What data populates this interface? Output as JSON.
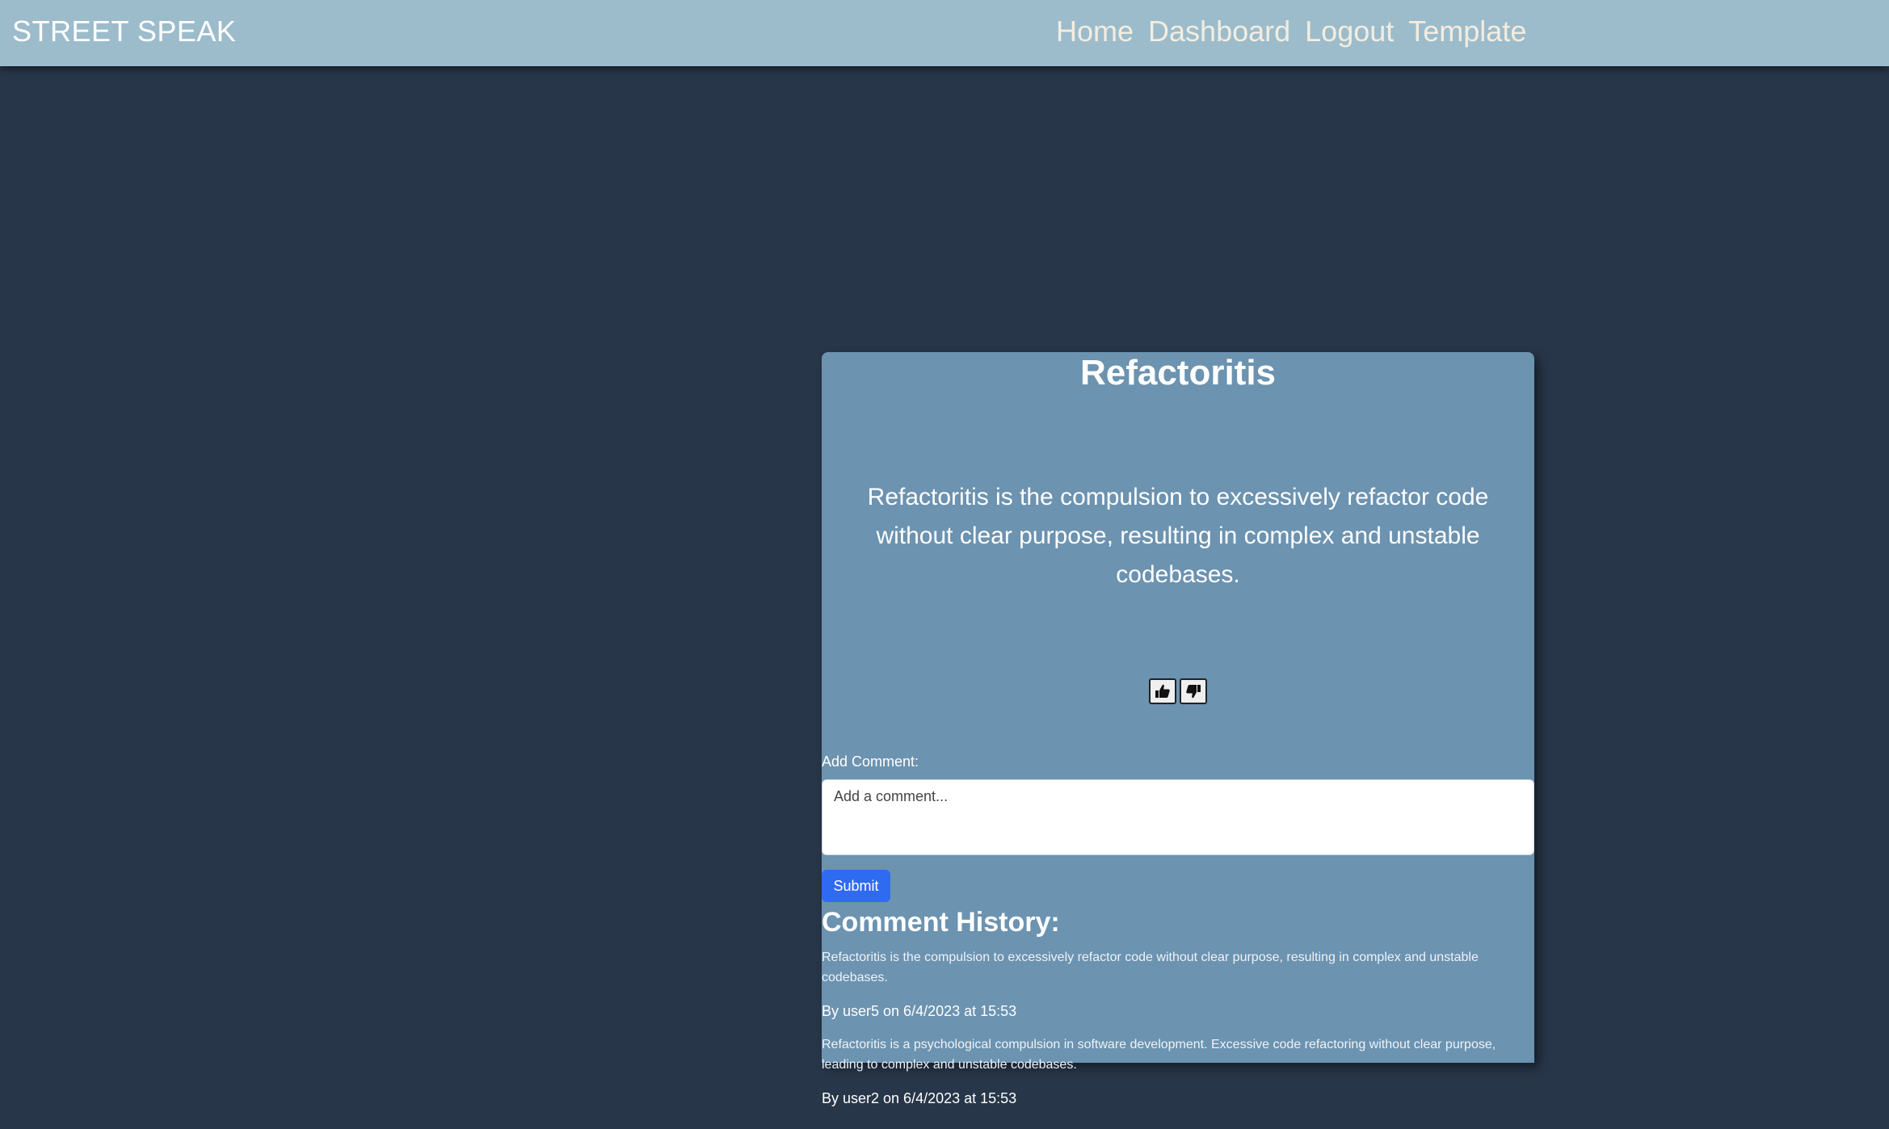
{
  "nav": {
    "brand": "STREET SPEAK",
    "links": [
      "Home",
      "Dashboard",
      "Logout",
      "Template"
    ]
  },
  "post": {
    "title": "Refactoritis",
    "definition": "Refactoritis is the compulsion to excessively refactor code without clear purpose, resulting in complex and unstable codebases.",
    "upvote_icon": "thumbs-up-icon",
    "downvote_icon": "thumbs-down-icon"
  },
  "comment_form": {
    "label": "Add Comment:",
    "placeholder": "Add a comment...",
    "submit_label": "Submit"
  },
  "history": {
    "title": "Comment History:",
    "comments": [
      {
        "text": "Refactoritis is the compulsion to excessively refactor code without clear purpose, resulting in complex and unstable codebases.",
        "meta": "By user5 on 6/4/2023 at 15:53"
      },
      {
        "text": "Refactoritis is a psychological compulsion in software development. Excessive code refactoring without clear purpose, leading to complex and unstable codebases.",
        "meta": "By user2 on 6/4/2023 at 15:53"
      }
    ]
  },
  "colors": {
    "page_background": "#283649",
    "navbar": "#9cbccb",
    "card": "#6c93b0",
    "submit_button": "#2f6bf0"
  }
}
